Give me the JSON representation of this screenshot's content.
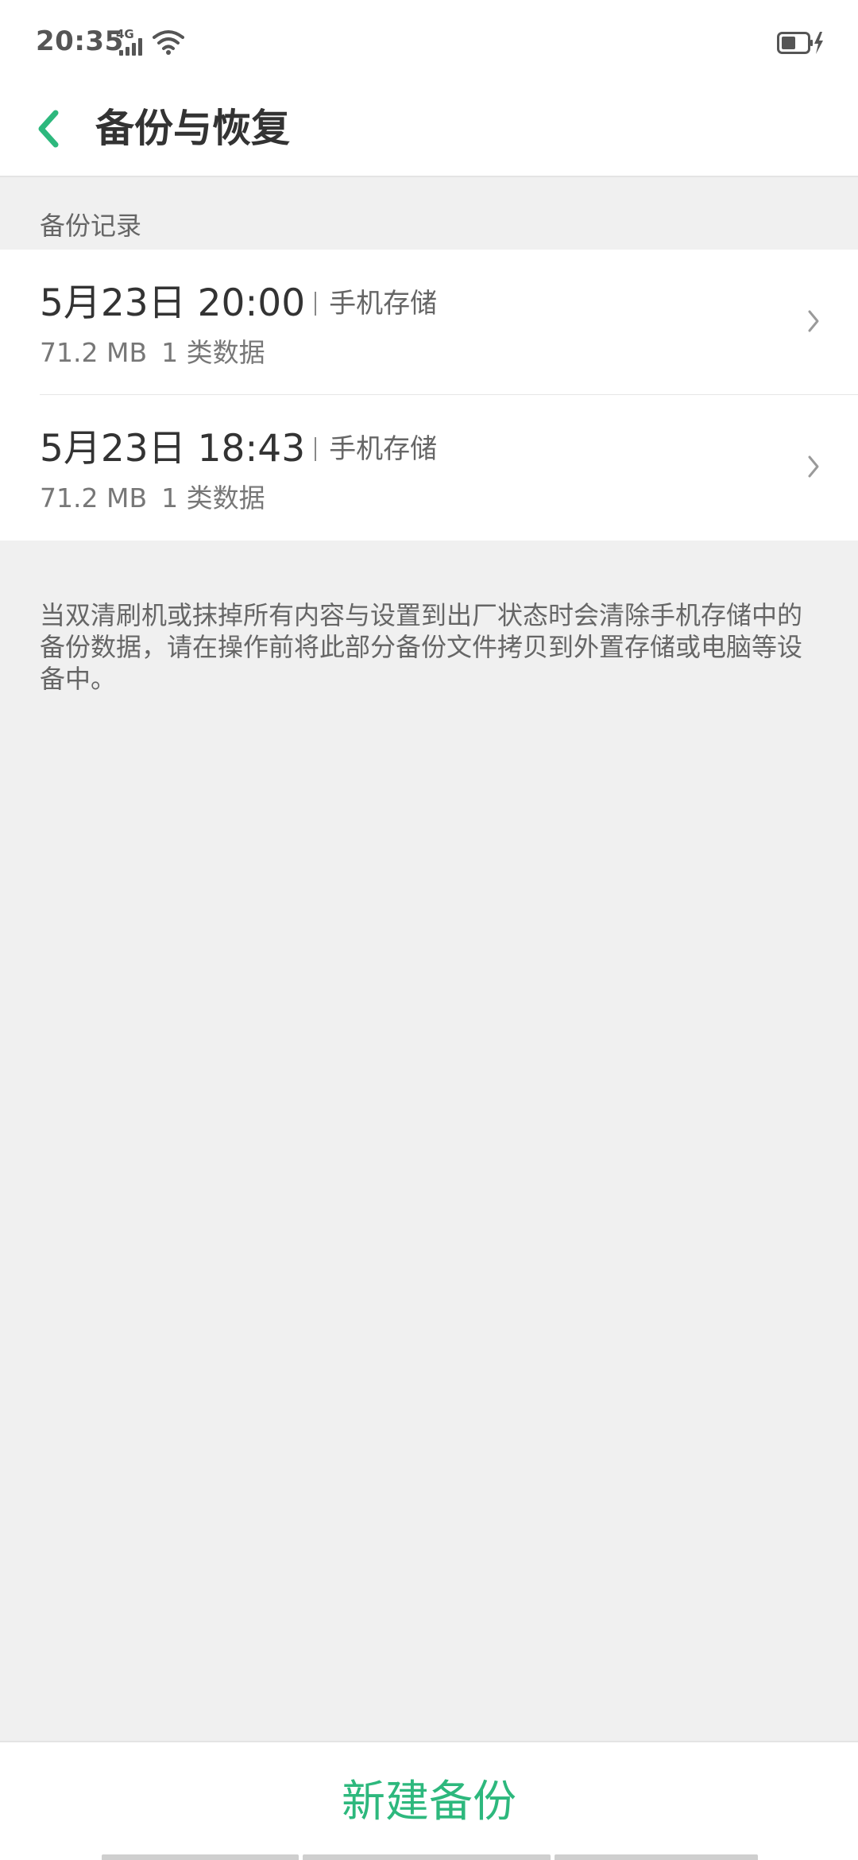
{
  "status_bar": {
    "time": "20:35",
    "network": "4G",
    "icons": [
      "signal-icon",
      "wifi-icon",
      "battery-charging-icon"
    ]
  },
  "header": {
    "back_icon": "back-arrow-icon",
    "title": "备份与恢复"
  },
  "section": {
    "title": "备份记录"
  },
  "backups": [
    {
      "date": "5月23日 20:00",
      "location": "手机存储",
      "size": "71.2 MB",
      "categories": "1 类数据"
    },
    {
      "date": "5月23日 18:43",
      "location": "手机存储",
      "size": "71.2 MB",
      "categories": "1 类数据"
    }
  ],
  "info_text": "当双清刷机或抹掉所有内容与设置到出厂状态时会清除手机存储中的备份数据，请在操作前将此部分备份文件拷贝到外置存储或电脑等设备中。",
  "bottom": {
    "new_backup_label": "新建备份"
  },
  "colors": {
    "accent": "#2db87d",
    "background": "#f0f0f0",
    "surface": "#ffffff",
    "text_primary": "#333333",
    "text_secondary": "#666666"
  }
}
